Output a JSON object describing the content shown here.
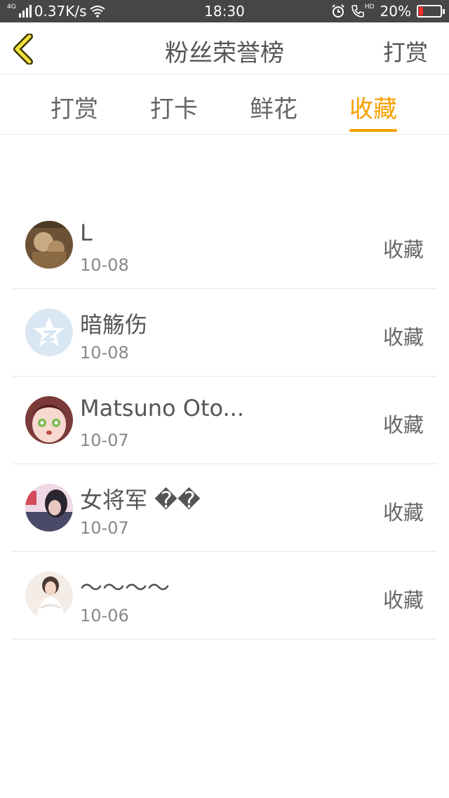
{
  "status_bar": {
    "network_type": "4G",
    "speed": "0.37K/s",
    "time": "18:30",
    "hd_label": "HD",
    "battery": "20%",
    "battery_level": 0.2,
    "icons": [
      "signal-icon",
      "wifi-icon",
      "alarm-icon",
      "call-hd-icon",
      "battery-icon"
    ]
  },
  "header": {
    "title": "粉丝荣誉榜",
    "right_label": "打赏",
    "accent_color": "#f5a000"
  },
  "tabs": [
    {
      "label": "打赏",
      "active": false
    },
    {
      "label": "打卡",
      "active": false
    },
    {
      "label": "鲜花",
      "active": false
    },
    {
      "label": "收藏",
      "active": true
    }
  ],
  "list": [
    {
      "name": "L",
      "date": "10-08",
      "action": "收藏"
    },
    {
      "name": "暗觞伤",
      "date": "10-08",
      "action": "收藏"
    },
    {
      "name": "Matsuno Oto...",
      "date": "10-07",
      "action": "收藏"
    },
    {
      "name": "女将军 ��",
      "date": "10-07",
      "action": "收藏"
    },
    {
      "name": "～～～～",
      "date": "10-06",
      "action": "收藏"
    }
  ]
}
